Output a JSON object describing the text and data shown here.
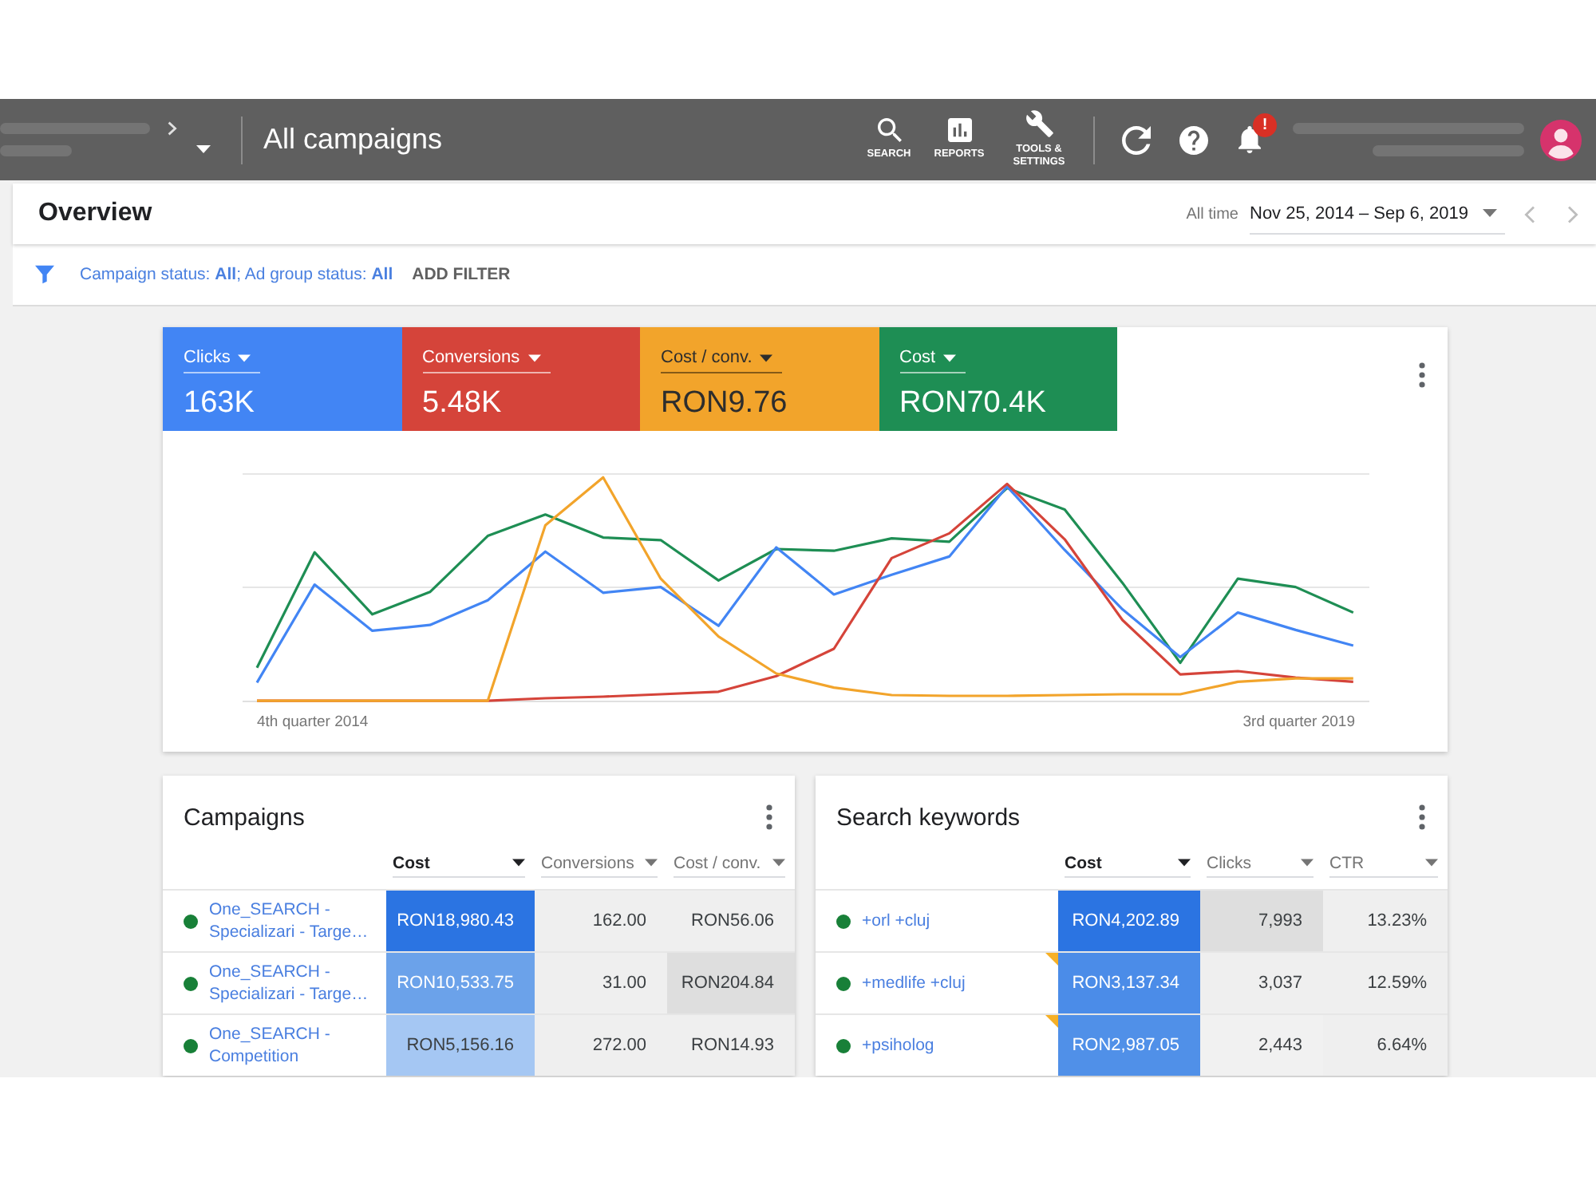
{
  "header": {
    "title": "All campaigns",
    "tools": [
      {
        "kind": "search",
        "label": "SEARCH"
      },
      {
        "kind": "reports",
        "label": "REPORTS"
      },
      {
        "kind": "tools",
        "label": "TOOLS & SETTINGS"
      }
    ],
    "notification_badge": "!"
  },
  "overview": {
    "title": "Overview",
    "range_label": "All time",
    "date_range": "Nov 25, 2014 – Sep 6, 2019"
  },
  "filter": {
    "text": "Campaign status: **All**; Ad group status: **All**",
    "add_filter": "ADD FILTER"
  },
  "chart_card": {
    "metrics": [
      {
        "label": "Clicks",
        "value": "163K",
        "color": "#4285f4"
      },
      {
        "label": "Conversions",
        "value": "5.48K",
        "color": "#d5443a"
      },
      {
        "label": "Cost / conv.",
        "value": "RON9.76",
        "color": "#f2a42b"
      },
      {
        "label": "Cost",
        "value": "RON70.4K",
        "color": "#1e8e54"
      }
    ],
    "x_labels": [
      "4th quarter 2014",
      "3rd quarter 2019"
    ]
  },
  "campaigns": {
    "title": "Campaigns",
    "columns": [
      {
        "label": "Cost",
        "sorted": true
      },
      {
        "label": "Conversions",
        "sorted": false
      },
      {
        "label": "Cost / conv.",
        "sorted": false
      }
    ],
    "rows": [
      {
        "name": "One_SEARCH - Specializari - Targe…",
        "color": "#188038",
        "cells": [
          {
            "text": "RON18,980.43",
            "color": "#2b74e2"
          },
          {
            "text": "162.00",
            "color": "#efefef"
          },
          {
            "text": "RON56.06",
            "color": "#efefef"
          }
        ]
      },
      {
        "name": "One_SEARCH - Specializari - Targe…",
        "color": "#188038",
        "cells": [
          {
            "text": "RON10,533.75",
            "color": "#6ba2ea"
          },
          {
            "text": "31.00",
            "color": "#efefef"
          },
          {
            "text": "RON204.84",
            "color": "#dedede"
          }
        ]
      },
      {
        "name": "One_SEARCH - Competition",
        "color": "#188038",
        "cells": [
          {
            "text": "RON5,156.16",
            "color": "#a5c7f3"
          },
          {
            "text": "272.00",
            "color": "#efefef"
          },
          {
            "text": "RON14.93",
            "color": "#efefef"
          }
        ]
      }
    ]
  },
  "keywords": {
    "title": "Search keywords",
    "columns": [
      {
        "label": "Cost",
        "sorted": true
      },
      {
        "label": "Clicks",
        "sorted": false
      },
      {
        "label": "CTR",
        "sorted": false
      }
    ],
    "rows": [
      {
        "name": "+orl +cluj",
        "color": "#188038",
        "flagged": false,
        "cells": [
          {
            "text": "RON4,202.89",
            "color": "#2b74e2"
          },
          {
            "text": "7,993",
            "color": "#dedede"
          },
          {
            "text": "13.23%",
            "color": "#efefef"
          }
        ]
      },
      {
        "name": "+medlife +cluj",
        "color": "#188038",
        "flagged": true,
        "cells": [
          {
            "text": "RON3,137.34",
            "color": "#4b8ce8"
          },
          {
            "text": "3,037",
            "color": "#efefef"
          },
          {
            "text": "12.59%",
            "color": "#efefef"
          }
        ]
      },
      {
        "name": "+psiholog",
        "color": "#188038",
        "flagged": true,
        "cells": [
          {
            "text": "RON2,987.05",
            "color": "#5090e8"
          },
          {
            "text": "2,443",
            "color": "#f1f1f1"
          },
          {
            "text": "6.64%",
            "color": "#efefef"
          }
        ]
      }
    ]
  }
}
